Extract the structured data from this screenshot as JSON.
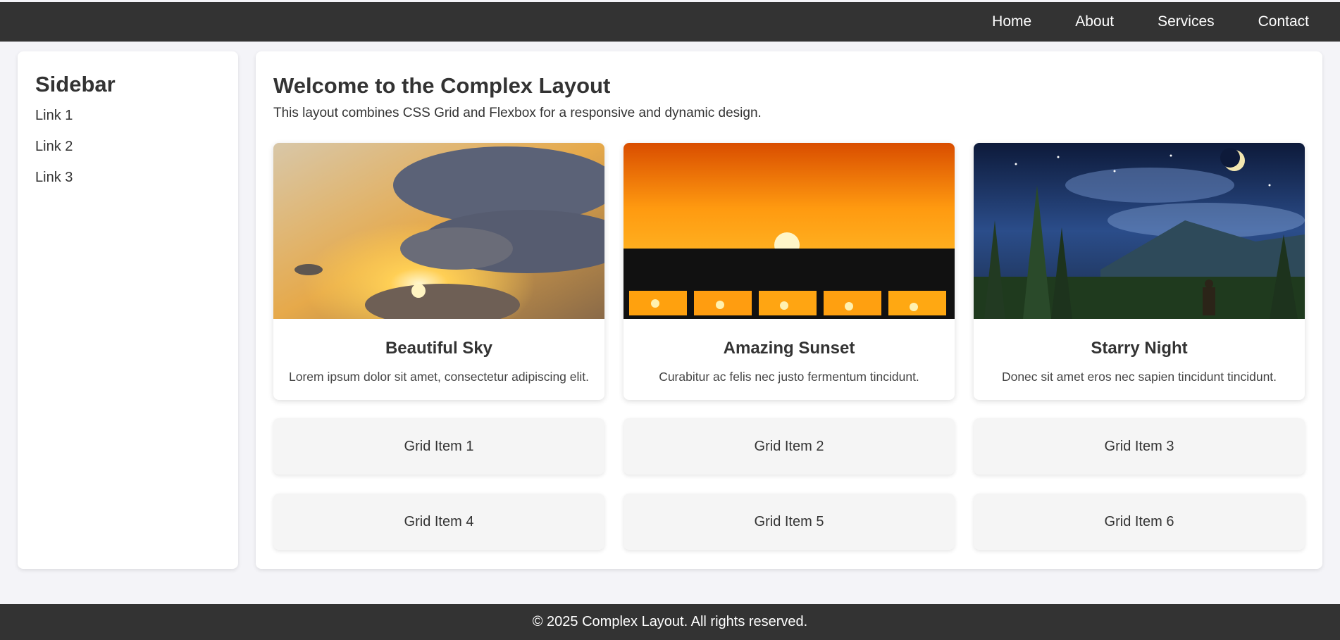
{
  "nav": {
    "items": [
      {
        "label": "Home"
      },
      {
        "label": "About"
      },
      {
        "label": "Services"
      },
      {
        "label": "Contact"
      }
    ]
  },
  "sidebar": {
    "title": "Sidebar",
    "links": [
      {
        "label": "Link 1"
      },
      {
        "label": "Link 2"
      },
      {
        "label": "Link 3"
      }
    ]
  },
  "main": {
    "title": "Welcome to the Complex Layout",
    "intro": "This layout combines CSS Grid and Flexbox for a responsive and dynamic design.",
    "cards": [
      {
        "title": "Beautiful Sky",
        "text": "Lorem ipsum dolor sit amet, consectetur adipiscing elit."
      },
      {
        "title": "Amazing Sunset",
        "text": "Curabitur ac felis nec justo fermentum tincidunt."
      },
      {
        "title": "Starry Night",
        "text": "Donec sit amet eros nec sapien tincidunt tincidunt."
      }
    ],
    "grid_items": [
      {
        "label": "Grid Item 1"
      },
      {
        "label": "Grid Item 2"
      },
      {
        "label": "Grid Item 3"
      },
      {
        "label": "Grid Item 4"
      },
      {
        "label": "Grid Item 5"
      },
      {
        "label": "Grid Item 6"
      }
    ]
  },
  "footer": {
    "text": "© 2025 Complex Layout. All rights reserved."
  },
  "colors": {
    "header_bg": "#333333",
    "page_bg": "#f4f4f8",
    "panel_bg": "#ffffff",
    "grid_item_bg": "#f5f5f5"
  }
}
